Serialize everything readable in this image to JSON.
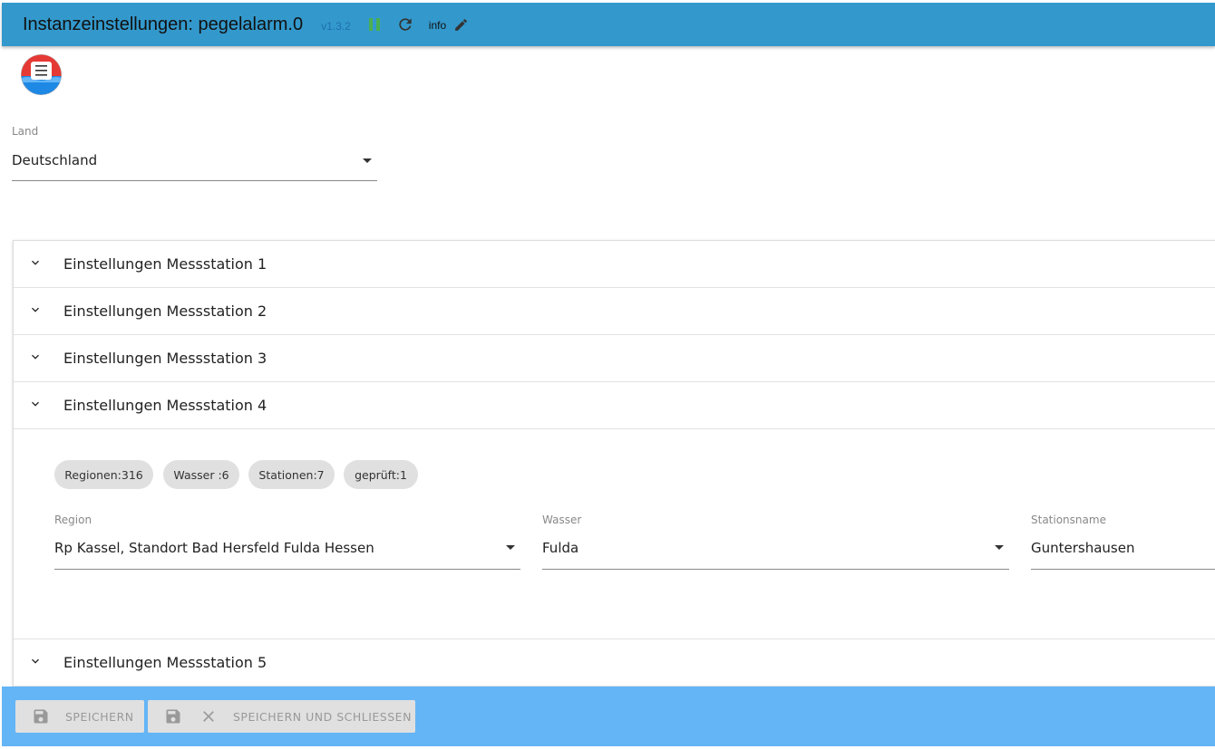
{
  "header": {
    "title": "Instanzeinstellungen: pegelalarm.0",
    "version": "v1.3.2",
    "info_label": "info",
    "pause_color": "#4caf50",
    "background": "#3399cc"
  },
  "icons": {
    "pause": "pause-icon",
    "reload": "reload-icon",
    "edit": "edit-icon",
    "chevron": "chevron-down-icon",
    "save": "floppy-icon",
    "close": "close-icon",
    "logo": "lifebuoy-logo"
  },
  "land": {
    "label": "Land",
    "value": "Deutschland"
  },
  "accordion": {
    "sections": [
      {
        "label": "Einstellungen Messstation 1",
        "expanded": false
      },
      {
        "label": "Einstellungen Messstation 2",
        "expanded": false
      },
      {
        "label": "Einstellungen Messstation 3",
        "expanded": false
      },
      {
        "label": "Einstellungen Messstation 4",
        "expanded": true
      },
      {
        "label": "Einstellungen Messstation 5",
        "expanded": false
      }
    ],
    "expanded": {
      "chips": [
        "Regionen:316",
        "Wasser :6",
        "Stationen:7",
        "geprüft:1"
      ],
      "fields": [
        {
          "label": "Region",
          "value": "Rp Kassel, Standort Bad Hersfeld Fulda Hessen",
          "type": "select"
        },
        {
          "label": "Wasser",
          "value": "Fulda",
          "type": "select"
        },
        {
          "label": "Stationsname",
          "value": "Guntershausen",
          "type": "select"
        }
      ]
    }
  },
  "footer": {
    "save_label": "SPEICHERN",
    "save_close_label": "SPEICHERN UND SCHLIESSEN",
    "background": "#64b5f6"
  }
}
